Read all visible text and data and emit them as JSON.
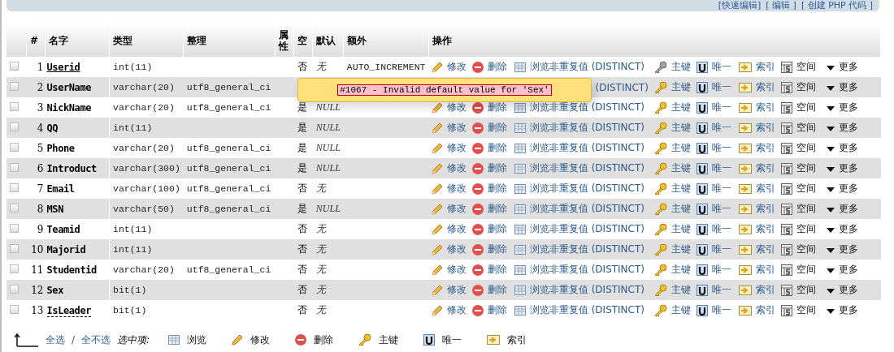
{
  "top_links": [
    "[快速编辑]",
    "[ 编辑 ]",
    "[ 创建 PHP 代码 ]"
  ],
  "columns": [
    "#",
    "名字",
    "类型",
    "整理",
    "属性",
    "空",
    "默认",
    "额外",
    "操作"
  ],
  "rows": [
    {
      "checked": false,
      "num": "1",
      "name": "Userid",
      "type": "int(11)",
      "collation": "",
      "null": "否",
      "default": "无",
      "extra": "AUTO_INCREMENT",
      "primary": true,
      "commented": false,
      "actions": [
        {
          "kind": "edit",
          "label": "修改"
        },
        {
          "kind": "drop",
          "label": "删除"
        },
        {
          "kind": "browse",
          "label": "浏览非重复值 (DISTINCT)"
        },
        {
          "kind": "primary",
          "label": "主键"
        },
        {
          "kind": "unique",
          "label": "唯一"
        },
        {
          "kind": "index",
          "label": "索引"
        },
        {
          "kind": "spatial",
          "label": "空间"
        },
        {
          "kind": "more",
          "label": "更多"
        }
      ]
    },
    {
      "checked": false,
      "num": "2",
      "name": "UserName",
      "type": "varchar(20)",
      "collation": "utf8_general_ci",
      "primary": false,
      "commented": false,
      "actions": [
        {
          "kind": "label",
          "label": "(DISTINCT)"
        },
        {
          "kind": "primary",
          "label": "主键"
        },
        {
          "kind": "unique",
          "label": "唯一"
        },
        {
          "kind": "index",
          "label": "索引"
        },
        {
          "kind": "spatial",
          "label": "空间"
        },
        {
          "kind": "more",
          "label": "更多"
        }
      ]
    },
    {
      "checked": false,
      "num": "3",
      "name": "NickName",
      "type": "varchar(20)",
      "collation": "utf8_general_ci",
      "null": "是",
      "default": "NULL",
      "primary": false,
      "commented": false,
      "actions": [
        {
          "kind": "edit",
          "label": "修改"
        },
        {
          "kind": "drop",
          "label": "删除"
        },
        {
          "kind": "browse",
          "label": "浏览非重复值 (DISTINCT)"
        },
        {
          "kind": "primary",
          "label": "主键"
        },
        {
          "kind": "unique",
          "label": "唯一"
        },
        {
          "kind": "index",
          "label": "索引"
        },
        {
          "kind": "spatial",
          "label": "空间"
        },
        {
          "kind": "more",
          "label": "更多"
        }
      ]
    },
    {
      "checked": false,
      "num": "4",
      "name": "QQ",
      "type": "int(11)",
      "collation": "",
      "null": "是",
      "default": "NULL",
      "primary": false,
      "commented": false,
      "actions": [
        {
          "kind": "edit",
          "label": "修改"
        },
        {
          "kind": "drop",
          "label": "删除"
        },
        {
          "kind": "browse",
          "label": "浏览非重复值 (DISTINCT)"
        },
        {
          "kind": "primary",
          "label": "主键"
        },
        {
          "kind": "unique",
          "label": "唯一"
        },
        {
          "kind": "index",
          "label": "索引"
        },
        {
          "kind": "spatial",
          "label": "空间"
        },
        {
          "kind": "more",
          "label": "更多"
        }
      ]
    },
    {
      "checked": false,
      "num": "5",
      "name": "Phone",
      "type": "varchar(20)",
      "collation": "utf8_general_ci",
      "null": "是",
      "default": "NULL",
      "primary": false,
      "commented": false,
      "actions": [
        {
          "kind": "edit",
          "label": "修改"
        },
        {
          "kind": "drop",
          "label": "删除"
        },
        {
          "kind": "browse",
          "label": "浏览非重复值 (DISTINCT)"
        },
        {
          "kind": "primary",
          "label": "主键"
        },
        {
          "kind": "unique",
          "label": "唯一"
        },
        {
          "kind": "index",
          "label": "索引"
        },
        {
          "kind": "spatial",
          "label": "空间"
        },
        {
          "kind": "more",
          "label": "更多"
        }
      ]
    },
    {
      "checked": false,
      "num": "6",
      "name": "Introduct",
      "type": "varchar(300)",
      "collation": "utf8_general_ci",
      "null": "是",
      "default": "NULL",
      "primary": false,
      "commented": false,
      "actions": [
        {
          "kind": "edit",
          "label": "修改"
        },
        {
          "kind": "drop",
          "label": "删除"
        },
        {
          "kind": "browse",
          "label": "浏览非重复值 (DISTINCT)"
        },
        {
          "kind": "primary",
          "label": "主键"
        },
        {
          "kind": "unique",
          "label": "唯一"
        },
        {
          "kind": "index",
          "label": "索引"
        },
        {
          "kind": "spatial",
          "label": "空间"
        },
        {
          "kind": "more",
          "label": "更多"
        }
      ]
    },
    {
      "checked": false,
      "num": "7",
      "name": "Email",
      "type": "varchar(100)",
      "collation": "utf8_general_ci",
      "null": "否",
      "default": "无",
      "primary": false,
      "commented": false,
      "actions": [
        {
          "kind": "edit",
          "label": "修改"
        },
        {
          "kind": "drop",
          "label": "删除"
        },
        {
          "kind": "browse",
          "label": "浏览非重复值 (DISTINCT)"
        },
        {
          "kind": "primary",
          "label": "主键"
        },
        {
          "kind": "unique",
          "label": "唯一"
        },
        {
          "kind": "index",
          "label": "索引"
        },
        {
          "kind": "spatial",
          "label": "空间"
        },
        {
          "kind": "more",
          "label": "更多"
        }
      ]
    },
    {
      "checked": false,
      "num": "8",
      "name": "MSN",
      "type": "varchar(50)",
      "collation": "utf8_general_ci",
      "null": "是",
      "default": "NULL",
      "primary": false,
      "commented": false,
      "actions": [
        {
          "kind": "edit",
          "label": "修改"
        },
        {
          "kind": "drop",
          "label": "删除"
        },
        {
          "kind": "browse",
          "label": "浏览非重复值 (DISTINCT)"
        },
        {
          "kind": "primary",
          "label": "主键"
        },
        {
          "kind": "unique",
          "label": "唯一"
        },
        {
          "kind": "index",
          "label": "索引"
        },
        {
          "kind": "spatial",
          "label": "空间"
        },
        {
          "kind": "more",
          "label": "更多"
        }
      ]
    },
    {
      "checked": false,
      "num": "9",
      "name": "Teamid",
      "type": "int(11)",
      "collation": "",
      "null": "否",
      "default": "无",
      "primary": false,
      "commented": false,
      "actions": [
        {
          "kind": "edit",
          "label": "修改"
        },
        {
          "kind": "drop",
          "label": "删除"
        },
        {
          "kind": "browse",
          "label": "浏览非重复值 (DISTINCT)"
        },
        {
          "kind": "primary",
          "label": "主键"
        },
        {
          "kind": "unique",
          "label": "唯一"
        },
        {
          "kind": "index",
          "label": "索引"
        },
        {
          "kind": "spatial",
          "label": "空间"
        },
        {
          "kind": "more",
          "label": "更多"
        }
      ]
    },
    {
      "checked": false,
      "num": "10",
      "name": "Majorid",
      "type": "int(11)",
      "collation": "",
      "null": "否",
      "default": "无",
      "primary": false,
      "commented": false,
      "actions": [
        {
          "kind": "edit",
          "label": "修改"
        },
        {
          "kind": "drop",
          "label": "删除"
        },
        {
          "kind": "browse",
          "label": "浏览非重复值 (DISTINCT)"
        },
        {
          "kind": "primary",
          "label": "主键"
        },
        {
          "kind": "unique",
          "label": "唯一"
        },
        {
          "kind": "index",
          "label": "索引"
        },
        {
          "kind": "spatial",
          "label": "空间"
        },
        {
          "kind": "more",
          "label": "更多"
        }
      ]
    },
    {
      "checked": false,
      "num": "11",
      "name": "Studentid",
      "type": "varchar(20)",
      "collation": "utf8_general_ci",
      "null": "否",
      "default": "无",
      "primary": false,
      "commented": false,
      "actions": [
        {
          "kind": "edit",
          "label": "修改"
        },
        {
          "kind": "drop",
          "label": "删除"
        },
        {
          "kind": "browse",
          "label": "浏览非重复值 (DISTINCT)"
        },
        {
          "kind": "primary",
          "label": "主键"
        },
        {
          "kind": "unique",
          "label": "唯一"
        },
        {
          "kind": "index",
          "label": "索引"
        },
        {
          "kind": "spatial",
          "label": "空间"
        },
        {
          "kind": "more",
          "label": "更多"
        }
      ]
    },
    {
      "checked": false,
      "num": "12",
      "name": "Sex",
      "type": "bit(1)",
      "collation": "",
      "null": "否",
      "default": "无",
      "primary": false,
      "commented": false,
      "actions": [
        {
          "kind": "edit",
          "label": "修改"
        },
        {
          "kind": "drop",
          "label": "删除"
        },
        {
          "kind": "browse",
          "label": "浏览非重复值 (DISTINCT)"
        },
        {
          "kind": "primary",
          "label": "主键"
        },
        {
          "kind": "unique",
          "label": "唯一"
        },
        {
          "kind": "index",
          "label": "索引"
        },
        {
          "kind": "spatial",
          "label": "空间"
        },
        {
          "kind": "more",
          "label": "更多"
        }
      ]
    },
    {
      "checked": false,
      "num": "13",
      "name": "IsLeader",
      "type": "bit(1)",
      "collation": "",
      "null": "否",
      "default": "无",
      "primary": false,
      "commented": true,
      "actions": [
        {
          "kind": "edit",
          "label": "修改"
        },
        {
          "kind": "drop",
          "label": "删除"
        },
        {
          "kind": "browse",
          "label": "浏览非重复值 (DISTINCT)"
        },
        {
          "kind": "primary",
          "label": "主键"
        },
        {
          "kind": "unique",
          "label": "唯一"
        },
        {
          "kind": "index",
          "label": "索引"
        },
        {
          "kind": "spatial",
          "label": "空间"
        },
        {
          "kind": "more",
          "label": "更多"
        }
      ]
    }
  ],
  "error_popup": {
    "message": "#1067 - Invalid default value for 'Sex'"
  },
  "footer": {
    "check_all": "全选",
    "separator": "/",
    "uncheck_all": "全不选",
    "with_selected": "选中项:",
    "actions": [
      {
        "kind": "browse",
        "label": "浏览"
      },
      {
        "kind": "edit",
        "label": "修改"
      },
      {
        "kind": "drop",
        "label": "删除"
      },
      {
        "kind": "primary",
        "label": "主键"
      },
      {
        "kind": "unique",
        "label": "唯一"
      },
      {
        "kind": "index",
        "label": "索引"
      }
    ]
  }
}
